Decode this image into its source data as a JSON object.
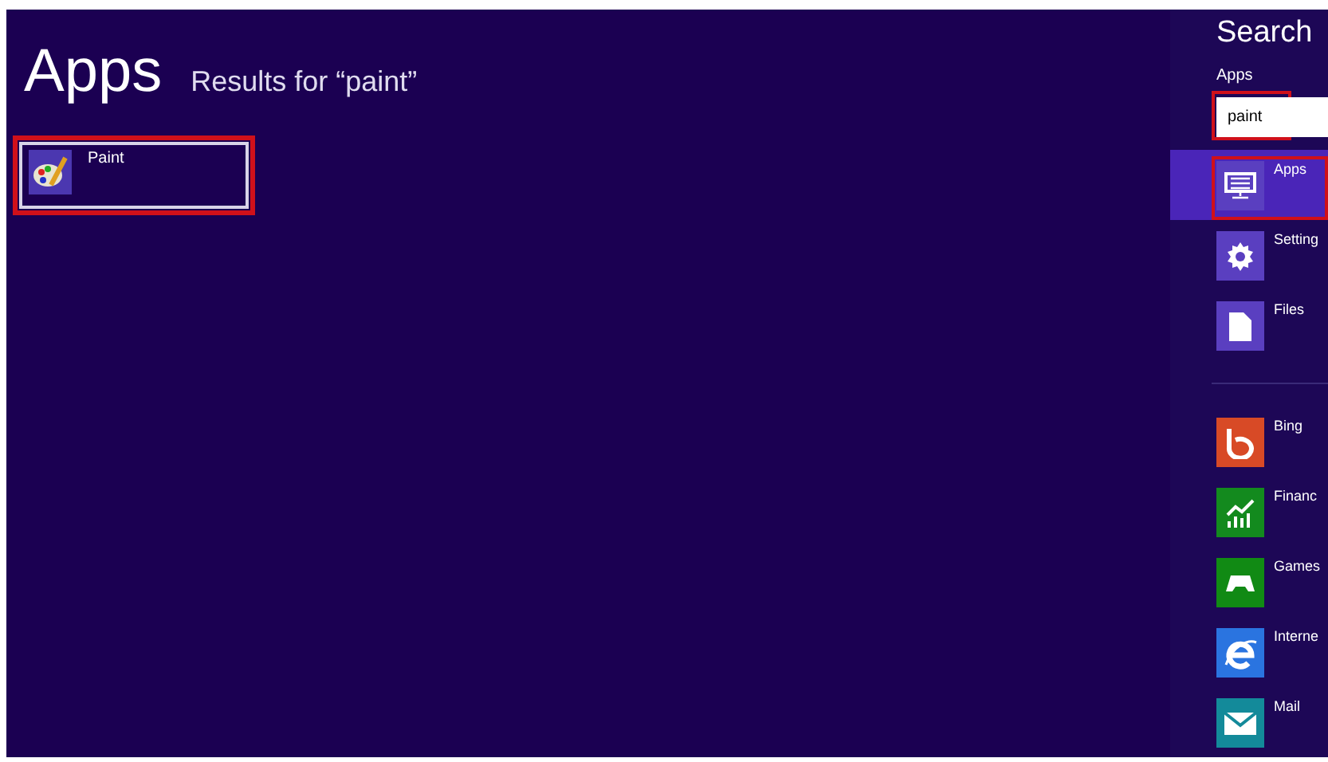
{
  "results": {
    "title": "Apps",
    "subtitle": "Results for “paint”",
    "items": [
      {
        "label": "Paint",
        "highlighted": true
      }
    ]
  },
  "charm": {
    "title": "Search",
    "scope": "Apps",
    "query": {
      "value": "paint",
      "highlighted": true
    },
    "groups": [
      [
        {
          "label": "Apps",
          "kind": "apps",
          "color": "#5a3fc0",
          "selected": true,
          "highlighted": true
        },
        {
          "label": "Setting",
          "kind": "settings",
          "color": "#5a3fc0",
          "selected": false,
          "highlighted": false
        },
        {
          "label": "Files",
          "kind": "file",
          "color": "#5a3fc0",
          "selected": false,
          "highlighted": false
        }
      ],
      [
        {
          "label": "Bing",
          "kind": "bing",
          "color": "#d84a26",
          "selected": false,
          "highlighted": false
        },
        {
          "label": "Financ",
          "kind": "finance",
          "color": "#138a1e",
          "selected": false,
          "highlighted": false
        },
        {
          "label": "Games",
          "kind": "games",
          "color": "#118a14",
          "selected": false,
          "highlighted": false
        },
        {
          "label": "Interne",
          "kind": "ie",
          "color": "#2a74e0",
          "selected": false,
          "highlighted": false
        },
        {
          "label": "Mail",
          "kind": "mail",
          "color": "#138a9a",
          "selected": false,
          "highlighted": false
        }
      ]
    ]
  }
}
